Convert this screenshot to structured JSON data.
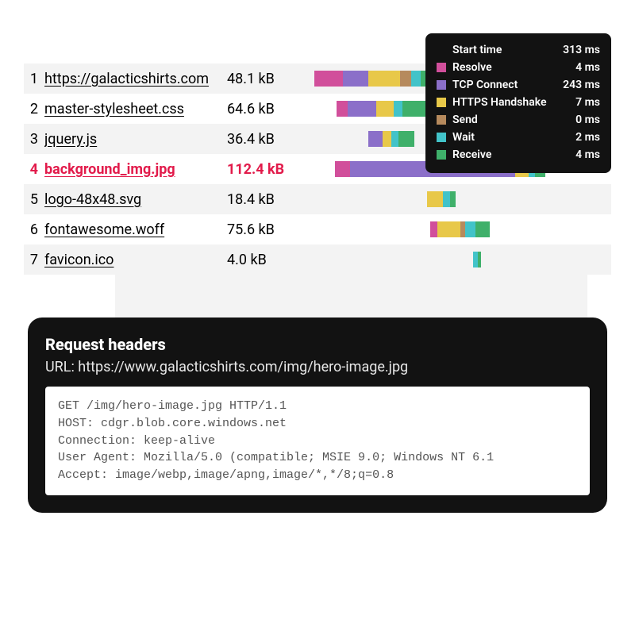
{
  "timelinePxPerMs": 0.8,
  "legend": {
    "start": {
      "label": "Start time",
      "value": "313 ms"
    },
    "phases": [
      {
        "key": "resolve",
        "label": "Resolve",
        "value": "4 ms",
        "colorClass": "c-resolve"
      },
      {
        "key": "tcp",
        "label": "TCP Connect",
        "value": "243 ms",
        "colorClass": "c-tcp"
      },
      {
        "key": "https",
        "label": "HTTPS Handshake",
        "value": "7 ms",
        "colorClass": "c-https"
      },
      {
        "key": "send",
        "label": "Send",
        "value": "0 ms",
        "colorClass": "c-send"
      },
      {
        "key": "wait",
        "label": "Wait",
        "value": "2 ms",
        "colorClass": "c-wait"
      },
      {
        "key": "receive",
        "label": "Receive",
        "value": "4 ms",
        "colorClass": "c-receive"
      }
    ]
  },
  "rows": [
    {
      "idx": "1",
      "name": "https://galacticshirts.com",
      "size": "48.1 kB",
      "selected": false,
      "start": 0,
      "phases": {
        "resolve": 45,
        "tcp": 40,
        "https": 50,
        "send": 18,
        "wait": 14,
        "receive": 62
      }
    },
    {
      "idx": "2",
      "name": "master-stylesheet.css",
      "size": "64.6 kB",
      "selected": false,
      "start": 35,
      "phases": {
        "resolve": 18,
        "tcp": 44,
        "https": 28,
        "send": 0,
        "wait": 14,
        "receive": 50
      }
    },
    {
      "idx": "3",
      "name": "jquery.js",
      "size": "36.4 kB",
      "selected": false,
      "start": 85,
      "phases": {
        "resolve": 0,
        "tcp": 22,
        "https": 14,
        "send": 0,
        "wait": 12,
        "receive": 24
      }
    },
    {
      "idx": "4",
      "name": "background_img.jpg",
      "size": "112.4 kB",
      "selected": true,
      "start": 32,
      "phases": {
        "resolve": 24,
        "tcp": 260,
        "https": 22,
        "send": 0,
        "wait": 10,
        "receive": 16
      }
    },
    {
      "idx": "5",
      "name": "logo-48x48.svg",
      "size": "18.4 kB",
      "selected": false,
      "start": 178,
      "phases": {
        "resolve": 0,
        "tcp": 0,
        "https": 24,
        "send": 0,
        "wait": 12,
        "receive": 8
      }
    },
    {
      "idx": "6",
      "name": "fontawesome.woff",
      "size": "75.6 kB",
      "selected": false,
      "start": 182,
      "phases": {
        "resolve": 12,
        "tcp": 0,
        "https": 36,
        "send": 8,
        "wait": 16,
        "receive": 22
      }
    },
    {
      "idx": "7",
      "name": "favicon.ico",
      "size": "4.0 kB",
      "selected": false,
      "start": 250,
      "phases": {
        "resolve": 0,
        "tcp": 0,
        "https": 0,
        "send": 0,
        "wait": 8,
        "receive": 4
      }
    }
  ],
  "headers": {
    "title": "Request headers",
    "url_label": "URL: https://www.galacticshirts.com/img/hero-image.jpg",
    "body": "GET /img/hero-image.jpg HTTP/1.1\nHOST: cdgr.blob.core.windows.net\nConnection: keep-alive\nUser Agent: Mozilla/5.0 (compatible; MSIE 9.0; Windows NT 6.1\nAccept: image/webp,image/apng,image/*,*/8;q=0.8"
  }
}
